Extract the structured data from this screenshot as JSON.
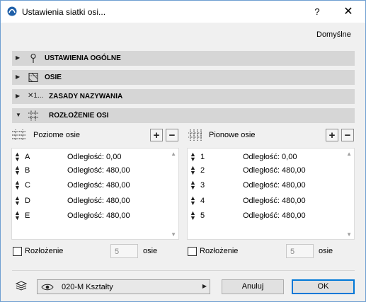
{
  "window": {
    "title": "Ustawienia siatki osi...",
    "help_label": "?",
    "close_label": "✕",
    "defaults_label": "Domyślne"
  },
  "sections": [
    {
      "label": "USTAWIENIA OGÓLNE",
      "icon": "pin-icon",
      "expanded": false
    },
    {
      "label": "OSIE",
      "icon": "axis-icon",
      "expanded": false
    },
    {
      "label": "ZASADY NAZYWANIA",
      "icon": "naming-icon",
      "prefix_text": "✕1...",
      "expanded": false
    },
    {
      "label": "ROZŁOŻENIE OSI",
      "icon": "grid-layout-icon",
      "expanded": true
    }
  ],
  "horizontal": {
    "title": "Poziome osie",
    "rows": [
      {
        "name": "A",
        "distance": "Odległość: 0,00"
      },
      {
        "name": "B",
        "distance": "Odległość: 480,00"
      },
      {
        "name": "C",
        "distance": "Odległość: 480,00"
      },
      {
        "name": "D",
        "distance": "Odległość: 480,00"
      },
      {
        "name": "E",
        "distance": "Odległość: 480,00"
      }
    ],
    "distribute_label": "Rozłożenie",
    "count": "5",
    "count_unit": "osie"
  },
  "vertical": {
    "title": "Pionowe osie",
    "rows": [
      {
        "name": "1",
        "distance": "Odległość: 0,00"
      },
      {
        "name": "2",
        "distance": "Odległość: 480,00"
      },
      {
        "name": "3",
        "distance": "Odległość: 480,00"
      },
      {
        "name": "4",
        "distance": "Odległość: 480,00"
      },
      {
        "name": "5",
        "distance": "Odległość: 480,00"
      }
    ],
    "distribute_label": "Rozłożenie",
    "count": "5",
    "count_unit": "osie"
  },
  "footer": {
    "layer_name": "020-M Kształty",
    "cancel_label": "Anuluj",
    "ok_label": "OK"
  },
  "colors": {
    "accent": "#0078d7",
    "section_bg": "#d6d6d6",
    "dialog_bg": "#f0f0f0"
  }
}
